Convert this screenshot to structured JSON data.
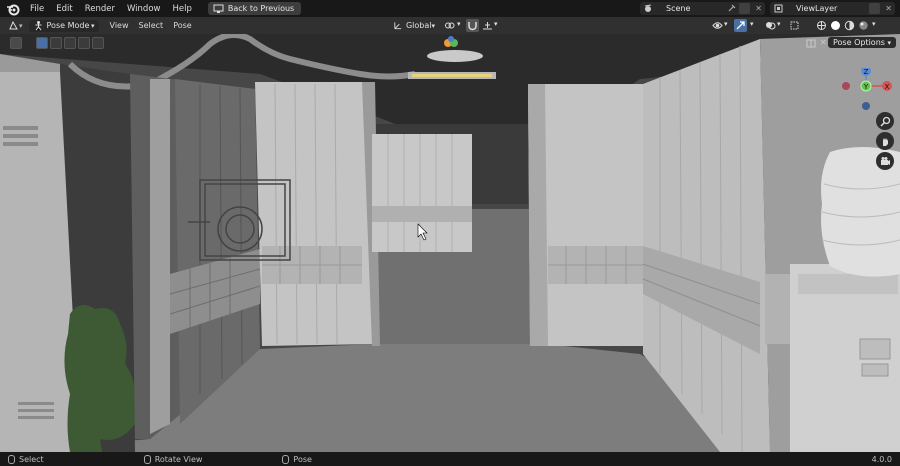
{
  "topbar": {
    "menus": [
      "File",
      "Edit",
      "Render",
      "Window",
      "Help"
    ],
    "back_button": "Back to Previous",
    "scene_name": "Scene",
    "view_layer": "ViewLayer"
  },
  "viewport_header": {
    "mode": "Pose Mode",
    "menus": [
      "View",
      "Select",
      "Pose"
    ],
    "transform_orientation": "Global"
  },
  "pose_options": "Pose Options",
  "gizmo": {
    "y": "Y",
    "z": "Z",
    "x": "X"
  },
  "statusbar": {
    "select": "Select",
    "rotate": "Rotate View",
    "pose": "Pose",
    "version": "4.0.0"
  }
}
